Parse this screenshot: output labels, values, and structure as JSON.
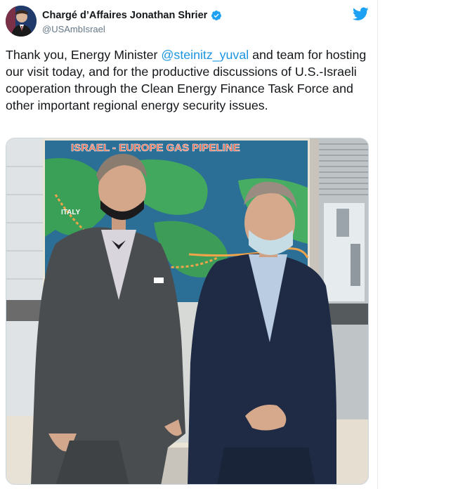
{
  "tweet": {
    "author_name": "Chargé d’Affaires Jonathan Shrier",
    "handle": "@USAmbIsrael",
    "text_before": "Thank you, Energy Minister ",
    "mention": "@steinitz_yuval",
    "text_after": " and team for hosting our visit today, and for the productive discussions of U.S.-Israeli cooperation through the Clean Energy Finance Task Force and other important regional energy security issues.",
    "icons": {
      "verified": "verified-badge-icon",
      "brand": "twitter-bird-icon"
    },
    "photo": {
      "map_title": "ISRAEL - EUROPE GAS PIPELINE",
      "map_label_italy": "ITALY"
    }
  },
  "colors": {
    "accent": "#1da1f2",
    "mention": "#1b95e0",
    "text": "#14171a",
    "secondary": "#657786"
  }
}
